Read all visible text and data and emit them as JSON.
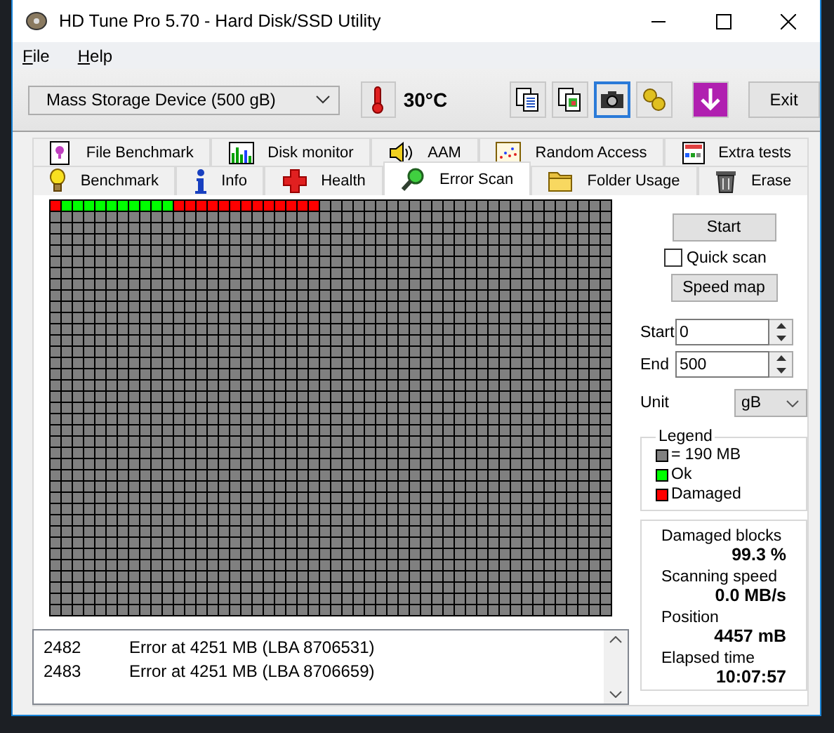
{
  "window": {
    "title": "HD Tune Pro 5.70 - Hard Disk/SSD Utility"
  },
  "menu": [
    {
      "label": "File"
    },
    {
      "label": "Help"
    }
  ],
  "toolbar": {
    "drive": "Mass Storage Device (500 gB)",
    "temperature": "30°C",
    "exit": "Exit",
    "buttons": [
      {
        "kind": "copy-text",
        "selected": false
      },
      {
        "kind": "copy-image",
        "selected": false
      },
      {
        "kind": "screenshot",
        "selected": true
      },
      {
        "kind": "options",
        "selected": false
      },
      {
        "kind": "save",
        "selected": false
      }
    ]
  },
  "tabs": [
    [
      {
        "label": "File Benchmark",
        "kind": "file",
        "selected": false
      },
      {
        "label": "Disk monitor",
        "kind": "monitor",
        "selected": false
      },
      {
        "label": "AAM",
        "kind": "speaker",
        "selected": false
      },
      {
        "label": "Random Access",
        "kind": "scatter",
        "selected": false
      },
      {
        "label": "Extra tests",
        "kind": "calc",
        "selected": false
      }
    ],
    [
      {
        "label": "Benchmark",
        "kind": "bulb",
        "selected": false
      },
      {
        "label": "Info",
        "kind": "info",
        "selected": false
      },
      {
        "label": "Health",
        "kind": "cross",
        "selected": false
      },
      {
        "label": "Error Scan",
        "kind": "magnifier",
        "selected": true
      },
      {
        "label": "Folder Usage",
        "kind": "folder",
        "selected": false
      },
      {
        "label": "Erase",
        "kind": "trash",
        "selected": false
      }
    ]
  ],
  "scan": {
    "blocks": [
      {
        "kind": "damaged"
      },
      {
        "kind": "ok"
      },
      {
        "kind": "ok"
      },
      {
        "kind": "ok"
      },
      {
        "kind": "ok"
      },
      {
        "kind": "ok"
      },
      {
        "kind": "ok"
      },
      {
        "kind": "ok"
      },
      {
        "kind": "ok"
      },
      {
        "kind": "ok"
      },
      {
        "kind": "ok"
      },
      {
        "kind": "damaged"
      },
      {
        "kind": "damaged"
      },
      {
        "kind": "damaged"
      },
      {
        "kind": "damaged"
      },
      {
        "kind": "damaged"
      },
      {
        "kind": "damaged"
      },
      {
        "kind": "damaged"
      },
      {
        "kind": "damaged"
      },
      {
        "kind": "damaged"
      },
      {
        "kind": "damaged"
      },
      {
        "kind": "damaged"
      },
      {
        "kind": "damaged"
      },
      {
        "kind": "damaged"
      }
    ]
  },
  "side": {
    "start_button": "Start",
    "quick_scan": {
      "label": "Quick scan",
      "checked": false
    },
    "speed_map": "Speed map",
    "start": {
      "label": "Start",
      "value": "0"
    },
    "end": {
      "label": "End",
      "value": "500"
    },
    "unit": {
      "label": "Unit",
      "value": "gB"
    },
    "legend": {
      "title": "Legend",
      "items": [
        {
          "kind": "unscanned",
          "label": "= 190 MB",
          "color": "#808080"
        },
        {
          "kind": "ok",
          "label": "Ok",
          "color": "#00ff00"
        },
        {
          "kind": "damaged",
          "label": "Damaged",
          "color": "#ff0000"
        }
      ]
    },
    "stats": [
      {
        "label": "Damaged blocks",
        "value": "99.3 %"
      },
      {
        "label": "Scanning speed",
        "value": "0.0 MB/s"
      },
      {
        "label": "Position",
        "value": "4457 mB"
      },
      {
        "label": "Elapsed time",
        "value": "10:07:57"
      }
    ]
  },
  "log": [
    {
      "number": "2482",
      "message": "Error at 4251 MB (LBA 8706531)"
    },
    {
      "number": "2483",
      "message": "Error at 4251 MB (LBA 8706659)"
    }
  ]
}
